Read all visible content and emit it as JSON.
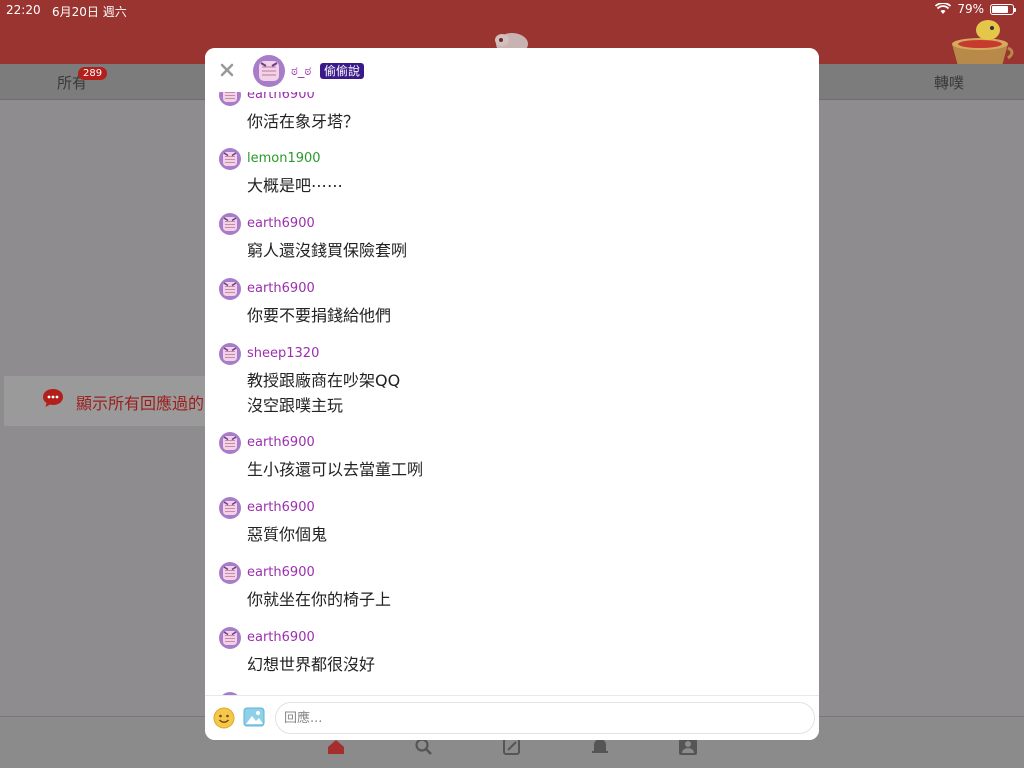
{
  "status_bar": {
    "time": "22:20",
    "date": "6月20日 週六",
    "battery": "79%",
    "battery_fraction": 0.79
  },
  "background": {
    "tabs": {
      "all_label": "所有",
      "all_badge": "289",
      "replurk_label": "轉噗"
    },
    "banner_text": "顯示所有回應過的"
  },
  "modal": {
    "header": {
      "name": "ಠ_ಠ",
      "badge": "偷偷說"
    },
    "messages": [
      {
        "user": "earth6900",
        "text": "你活在象牙塔？"
      },
      {
        "user": "lemon1900",
        "text": "大概是吧⋯⋯"
      },
      {
        "user": "earth6900",
        "text": "窮人還沒錢買保險套咧"
      },
      {
        "user": "earth6900",
        "text": "你要不要捐錢給他們"
      },
      {
        "user": "sheep1320",
        "text": "教授跟廠商在吵架QQ\n沒空跟噗主玩"
      },
      {
        "user": "earth6900",
        "text": "生小孩還可以去當童工咧"
      },
      {
        "user": "earth6900",
        "text": "惡質你個鬼"
      },
      {
        "user": "earth6900",
        "text": "你就坐在你的椅子上"
      },
      {
        "user": "earth6900",
        "text": "幻想世界都很沒好"
      }
    ],
    "composer": {
      "placeholder": "回應..."
    }
  }
}
